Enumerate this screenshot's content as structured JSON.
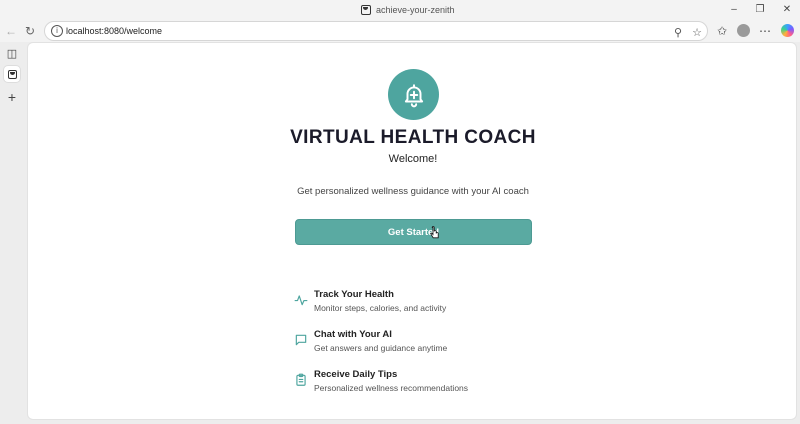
{
  "browser": {
    "tab_title": "achieve-your-zenith",
    "url": "localhost:8080/welcome"
  },
  "page": {
    "title": "VIRTUAL HEALTH COACH",
    "welcome": "Welcome!",
    "tagline": "Get personalized wellness guidance with your AI coach",
    "cta_label": "Get Started",
    "features": [
      {
        "icon": "activity-icon",
        "title": "Track Your Health",
        "description": "Monitor steps, calories, and activity"
      },
      {
        "icon": "chat-bubble-icon",
        "title": "Chat with Your AI",
        "description": "Get answers and guidance anytime"
      },
      {
        "icon": "clipboard-icon",
        "title": "Receive Daily Tips",
        "description": "Personalized wellness recommendations"
      }
    ]
  },
  "colors": {
    "accent": "#5aaaa2",
    "logo_bg": "#4ea59f",
    "title": "#1b1b2a"
  }
}
